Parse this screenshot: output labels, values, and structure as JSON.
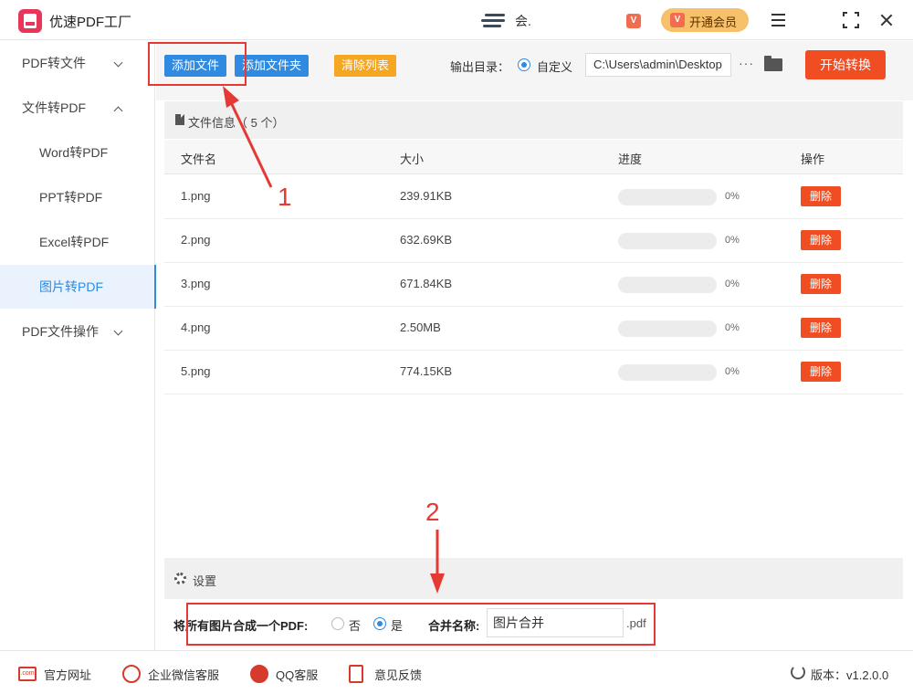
{
  "app": {
    "title": "优速PDF工厂",
    "user_name": "会.",
    "vip_badge": "V",
    "vip_button": "开通会员"
  },
  "sidebar": {
    "items": [
      {
        "label": "PDF转文件"
      },
      {
        "label": "文件转PDF"
      },
      {
        "label": "Word转PDF"
      },
      {
        "label": "PPT转PDF"
      },
      {
        "label": "Excel转PDF"
      },
      {
        "label": "图片转PDF"
      },
      {
        "label": "PDF文件操作"
      }
    ]
  },
  "toolbar": {
    "add_file": "添加文件",
    "add_folder": "添加文件夹",
    "clear_list": "清除列表",
    "output_label": "输出目录：",
    "custom_label": "自定义",
    "output_path": "C:\\Users\\admin\\Desktop",
    "more": "···",
    "start": "开始转换"
  },
  "files": {
    "header": "文件信息（ 5 个）",
    "columns": {
      "name": "文件名",
      "size": "大小",
      "progress": "进度",
      "action": "操作"
    },
    "rows": [
      {
        "name": "1.png",
        "size": "239.91KB",
        "progress": 0,
        "progress_text": "0%",
        "action": "删除"
      },
      {
        "name": "2.png",
        "size": "632.69KB",
        "progress": 0,
        "progress_text": "0%",
        "action": "删除"
      },
      {
        "name": "3.png",
        "size": "671.84KB",
        "progress": 0,
        "progress_text": "0%",
        "action": "删除"
      },
      {
        "name": "4.png",
        "size": "2.50MB",
        "progress": 0,
        "progress_text": "0%",
        "action": "删除"
      },
      {
        "name": "5.png",
        "size": "774.15KB",
        "progress": 0,
        "progress_text": "0%",
        "action": "删除"
      }
    ]
  },
  "settings": {
    "title": "设置",
    "merge_label": "将所有图片合成一个PDF:",
    "no_label": "否",
    "yes_label": "是",
    "selected": "yes",
    "name_label": "合并名称:",
    "name_value": "图片合并",
    "ext": ".pdf"
  },
  "annotations": {
    "one": "1",
    "two": "2"
  },
  "status": {
    "website": "官方网址",
    "website_icon_text": ".com",
    "wechat": "企业微信客服",
    "qq": "QQ客服",
    "feedback": "意见反馈",
    "version": "版本：v1.2.0.0"
  },
  "colors": {
    "accent": "#2f8ae0",
    "danger": "#f04d23",
    "warn": "#f5a623",
    "annotation": "#e53935"
  }
}
